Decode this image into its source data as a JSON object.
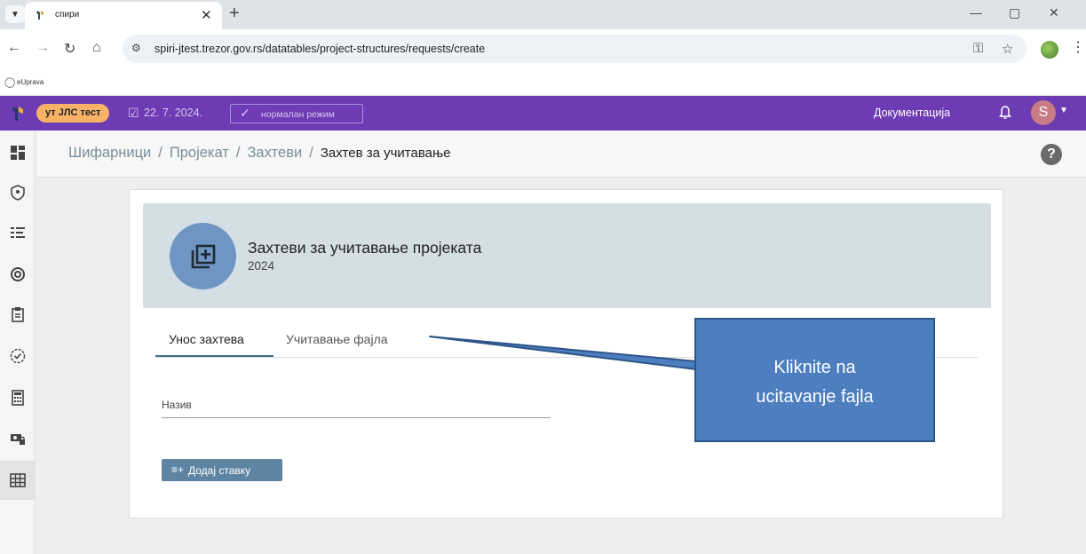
{
  "browser": {
    "tab_title": "спири",
    "url": "spiri-jtest.trezor.gov.rs/datatables/project-structures/requests/create",
    "bookmark_label": "eUprava"
  },
  "header": {
    "env_badge": "ут ЈЛС тест",
    "date": "22. 7. 2024.",
    "mode": "нормалан режим",
    "documentation": "Документација",
    "user_initial": "S"
  },
  "breadcrumb": {
    "items": [
      "Шифарници",
      "Пројекат",
      "Захтеви"
    ],
    "current": "Захтев за учитавање"
  },
  "hero": {
    "title": "Захтеви за учитавање пројеката",
    "year": "2024"
  },
  "tabs": [
    "Унос захтева",
    "Учитавање фајла"
  ],
  "form": {
    "name_label": "Назив",
    "add_button": "Додај ставку"
  },
  "callout": {
    "line1": "Kliknite na",
    "line2": "ucitavanje fajla",
    "fill_color": "#4d7ec0"
  },
  "colors": {
    "header_bg": "#6d3bb3",
    "env_badge": "#f7b267",
    "accent": "#5e84a4",
    "hero_bg": "#d3dee5"
  }
}
